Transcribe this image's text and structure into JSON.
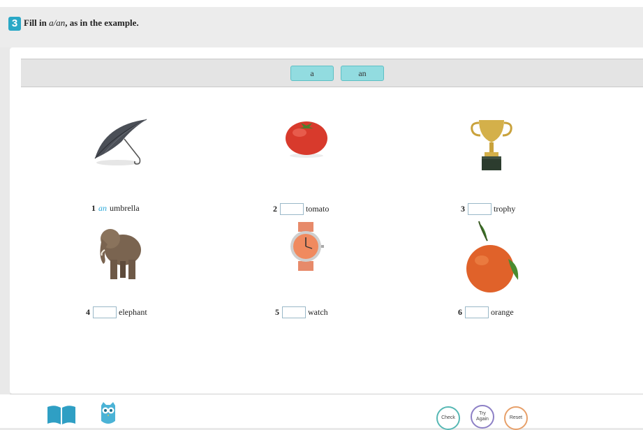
{
  "exercise": {
    "number": "3",
    "instruction_prefix": "Fill in ",
    "instruction_italic": "a/an",
    "instruction_suffix": ", as in the example."
  },
  "chips": [
    "a",
    "an"
  ],
  "items": [
    {
      "number": "1",
      "filled": "an",
      "word": "umbrella",
      "icon": "umbrella-icon"
    },
    {
      "number": "2",
      "filled": "",
      "word": "tomato",
      "icon": "tomato-icon"
    },
    {
      "number": "3",
      "filled": "",
      "word": "trophy",
      "icon": "trophy-icon"
    },
    {
      "number": "4",
      "filled": "",
      "word": "elephant",
      "icon": "elephant-icon"
    },
    {
      "number": "5",
      "filled": "",
      "word": "watch",
      "icon": "watch-icon"
    },
    {
      "number": "6",
      "filled": "",
      "word": "orange",
      "icon": "orange-icon"
    }
  ],
  "footer": {
    "check_label": "Check",
    "try_label_1": "Try",
    "try_label_2": "Again",
    "reset_label": "Reset"
  },
  "colors": {
    "accent": "#2aa8c6",
    "chip": "#92dce0",
    "check_ring": "#57b8b4",
    "try_ring": "#8d80c6",
    "reset_ring": "#e7a06a"
  }
}
